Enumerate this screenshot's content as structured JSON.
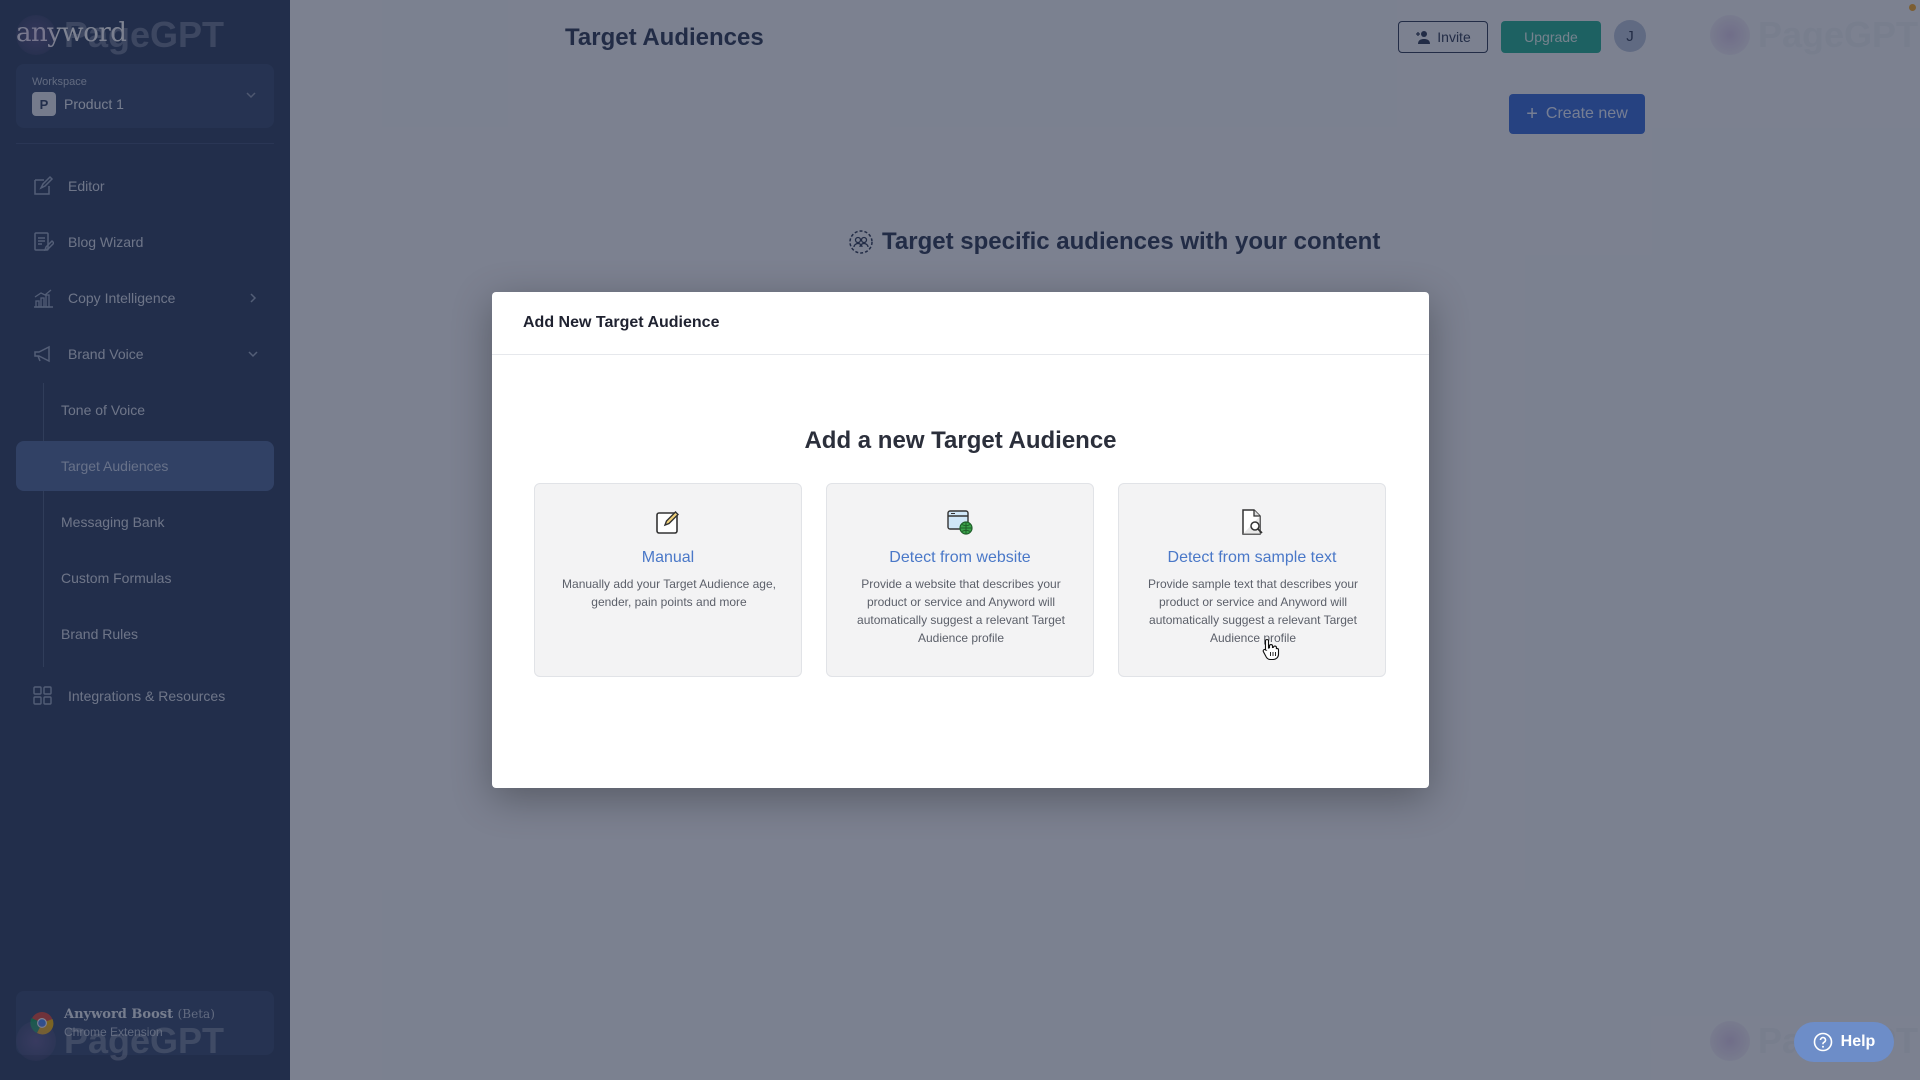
{
  "sidebar": {
    "logo": "anyword",
    "workspace": {
      "label": "Workspace",
      "badge": "P",
      "name": "Product 1"
    },
    "nav": [
      {
        "label": "Editor",
        "icon": "edit-icon"
      },
      {
        "label": "Blog Wizard",
        "icon": "blog-icon"
      },
      {
        "label": "Copy Intelligence",
        "icon": "chart-icon",
        "chevron": "right"
      },
      {
        "label": "Brand Voice",
        "icon": "megaphone-icon",
        "chevron": "down"
      }
    ],
    "brand_voice_items": [
      {
        "label": "Tone of Voice",
        "active": false
      },
      {
        "label": "Target Audiences",
        "active": true
      },
      {
        "label": "Messaging Bank",
        "active": false
      },
      {
        "label": "Custom Formulas",
        "active": false
      },
      {
        "label": "Brand Rules",
        "active": false
      }
    ],
    "integrations": {
      "label": "Integrations & Resources",
      "icon": "grid-icon"
    },
    "boost": {
      "title": "Anyword Boost",
      "beta": "(Beta)",
      "subtitle": "Chrome Extension"
    }
  },
  "header": {
    "title": "Target Audiences",
    "invite_label": "Invite",
    "upgrade_label": "Upgrade",
    "avatar_initial": "J",
    "create_label": "Create new"
  },
  "hero": {
    "text": "Target specific audiences with your content"
  },
  "watermark": {
    "text": "PageGPT"
  },
  "help": {
    "label": "Help"
  },
  "modal": {
    "title": "Add New Target Audience",
    "heading": "Add a new Target Audience",
    "options": [
      {
        "title": "Manual",
        "description": "Manually add your Target Audience age, gender, pain points and more",
        "icon": "edit-note-icon"
      },
      {
        "title": "Detect from website",
        "description": "Provide a website that describes your product or service and Anyword will automatically suggest a relevant Target Audience profile",
        "icon": "website-globe-icon"
      },
      {
        "title": "Detect from sample text",
        "description": "Provide sample text that describes your product or service and Anyword will automatically suggest a relevant Target Audience profile",
        "icon": "document-search-icon"
      }
    ]
  },
  "colors": {
    "sidebar_bg": "#2a3a5c",
    "accent_blue": "#3468d6",
    "upgrade_green": "#1eae8f",
    "option_title": "#4a78c8"
  }
}
